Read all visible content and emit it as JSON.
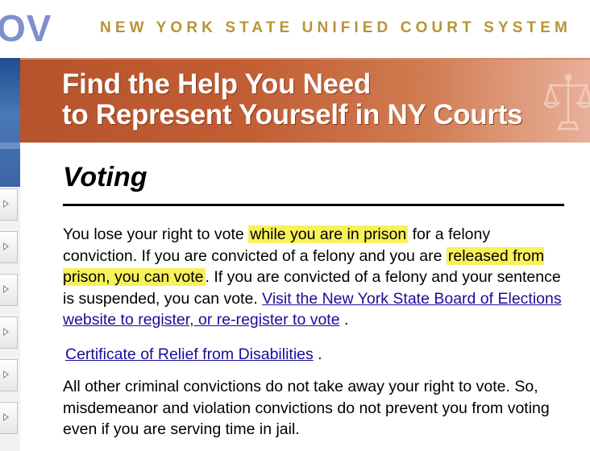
{
  "header": {
    "logo_text": "OV",
    "court_name": "NEW YORK STATE UNIFIED COURT SYSTEM"
  },
  "banner": {
    "line1": "Find the Help You Need",
    "line2": "to Represent Yourself in NY Courts",
    "icon": "scales-of-justice-icon"
  },
  "sidebar": {
    "button_icon": "chevron-right-icon",
    "button_count": 6
  },
  "page": {
    "title": "Voting",
    "p1": {
      "t1": "You lose your right to vote ",
      "h1": "while you are in prison",
      "t2": " for a felony conviction. If you are convicted of a felony and you are ",
      "h2": "released from prison, you can vote",
      "t3": ". If you are convicted of a felony and your sentence is suspended, you can vote. ",
      "link": "Visit the New York State Board of Elections website to register, or re-register to vote",
      "t4": " ."
    },
    "cert_link": "Certificate of Relief from Disabilities",
    "cert_after": " .",
    "p3": "All other criminal convictions do not take away your right to vote. So, misdemeanor and violation convictions do not prevent you from voting even if you are serving time in jail."
  },
  "colors": {
    "highlight": "#f8f15a",
    "link": "#1a0d99",
    "banner": "#b5532c",
    "court_name": "#b89436"
  }
}
